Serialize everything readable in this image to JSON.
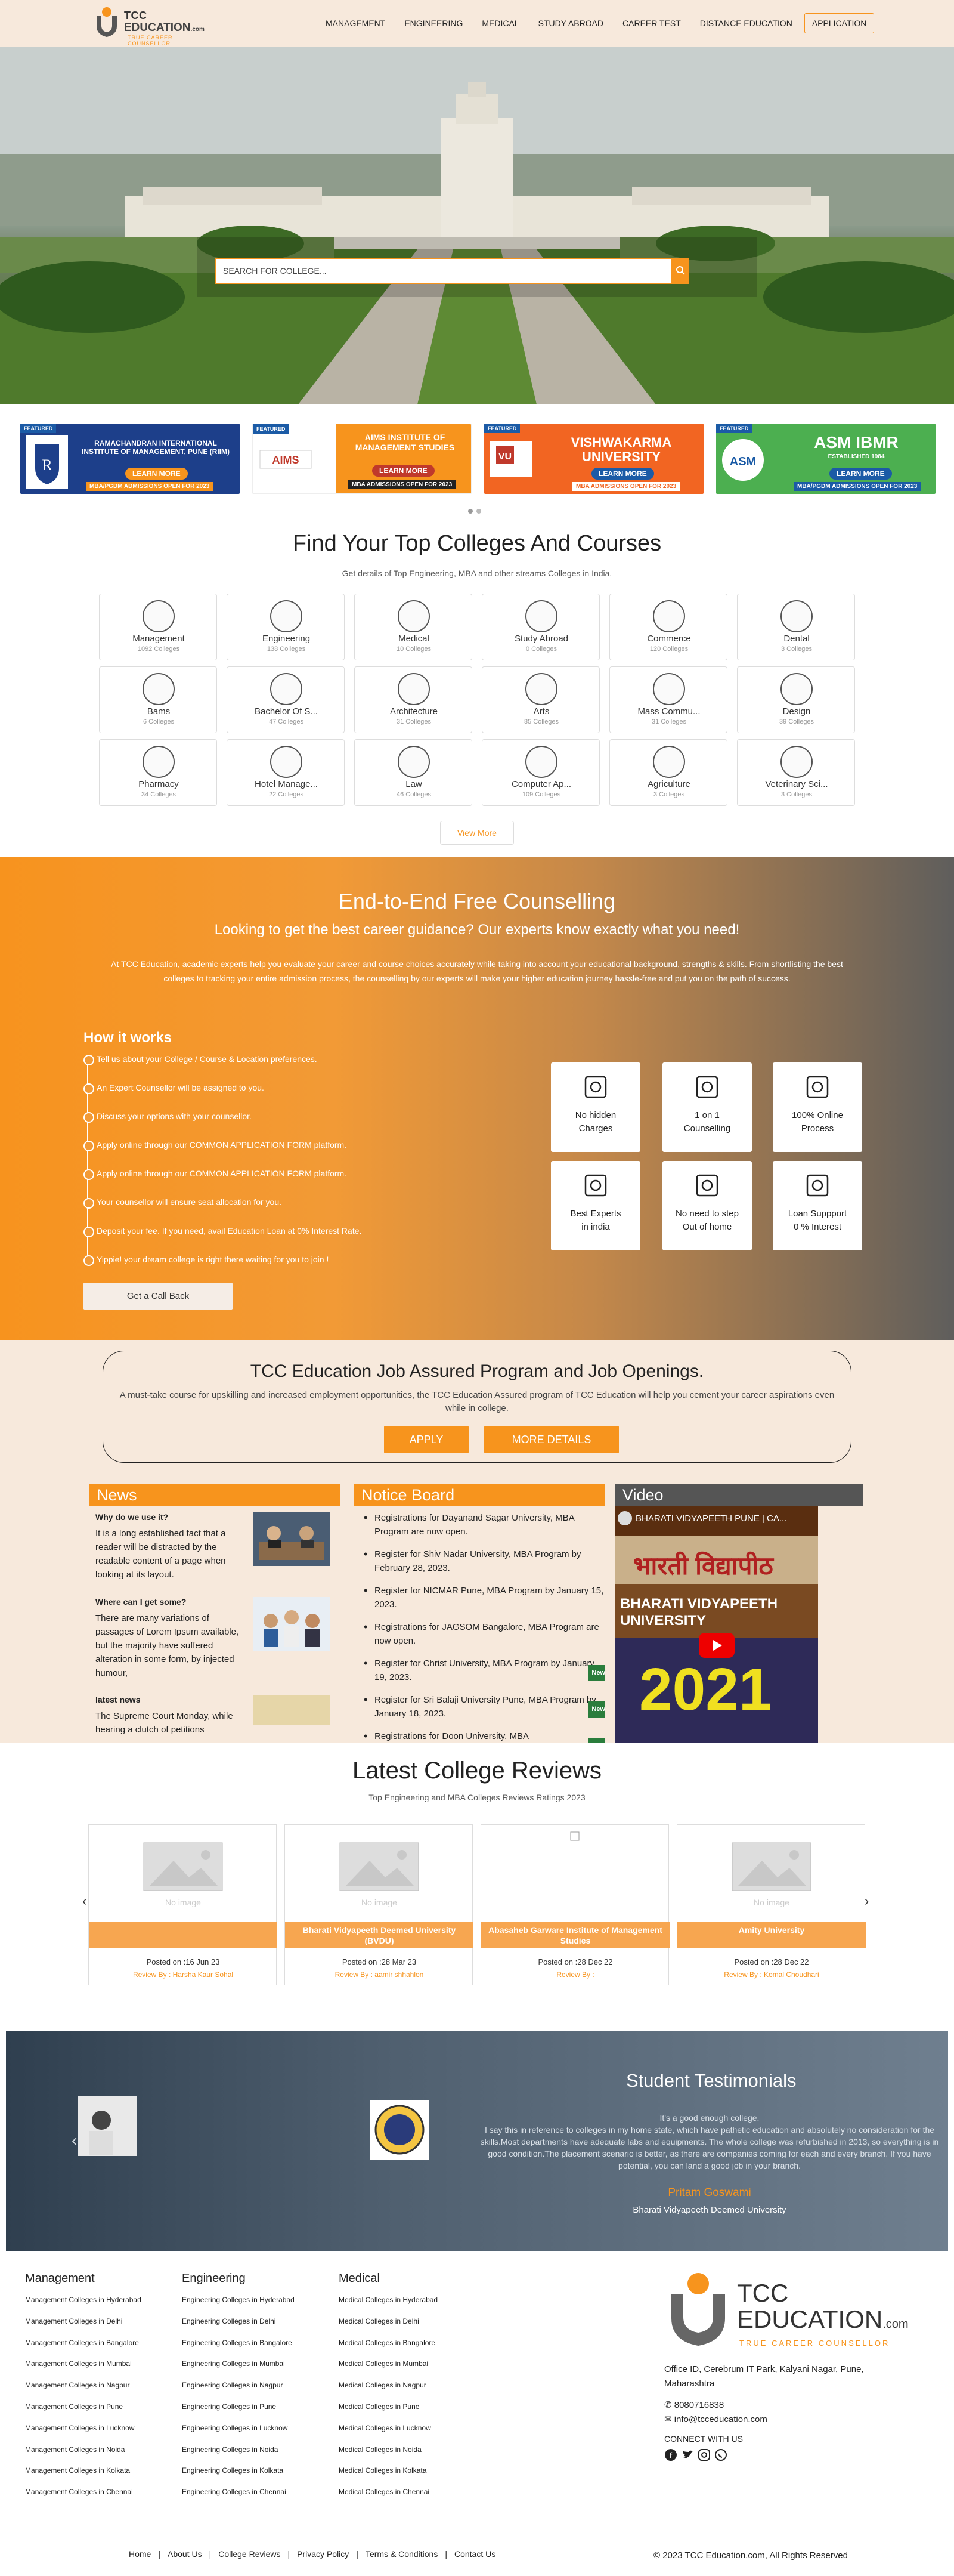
{
  "header": {
    "logo_line1": "TCC",
    "logo_line2": "EDUCATION",
    "logo_com": ".com",
    "logo_tagline": "TRUE CAREER COUNSELLOR",
    "nav": [
      "MANAGEMENT",
      "ENGINEERING",
      "MEDICAL",
      "STUDY ABROAD",
      "CAREER TEST",
      "DISTANCE EDUCATION"
    ],
    "application_label": "APPLICATION"
  },
  "hero": {
    "search_placeholder": "SEARCH FOR COLLEGE...",
    "search_icon": "search-icon"
  },
  "banners": [
    {
      "featured": "FEATURED",
      "title": "RAMACHANDRAN INTERNATIONAL INSTITUTE OF MANAGEMENT, PUNE (RIIM)",
      "learn": "LEARN MORE",
      "admission": "MBA/PGDM ADMISSIONS OPEN FOR 2023"
    },
    {
      "featured": "FEATURED",
      "title": "AIMS INSTITUTE OF MANAGEMENT STUDIES",
      "learn": "LEARN MORE",
      "admission": "MBA ADMISSIONS OPEN FOR 2023"
    },
    {
      "featured": "FEATURED",
      "title": "VISHWAKARMA UNIVERSITY",
      "learn": "LEARN MORE",
      "admission": "MBA ADMISSIONS OPEN FOR 2023"
    },
    {
      "featured": "FEATURED",
      "title": "ASM IBMR",
      "subtitle": "ESTABLISHED 1984",
      "learn": "LEARN MORE",
      "admission": "MBA/PGDM ADMISSIONS OPEN FOR 2023"
    }
  ],
  "top_colleges": {
    "title": "Find Your Top Colleges And Courses",
    "subtitle": "Get details of Top Engineering, MBA and other streams Colleges in India.",
    "items": [
      {
        "name": "Management",
        "count": "1092 Colleges",
        "icon": "management-icon"
      },
      {
        "name": "Engineering",
        "count": "138 Colleges",
        "icon": "engineering-icon"
      },
      {
        "name": "Medical",
        "count": "10 Colleges",
        "icon": "medical-icon"
      },
      {
        "name": "Study Abroad",
        "count": "0 Colleges",
        "icon": "globe-icon"
      },
      {
        "name": "Commerce",
        "count": "120 Colleges",
        "icon": "commerce-icon"
      },
      {
        "name": "Dental",
        "count": "3 Colleges",
        "icon": "tooth-icon"
      },
      {
        "name": "Bams",
        "count": "6 Colleges",
        "icon": "bams-icon"
      },
      {
        "name": "Bachelor Of S...",
        "count": "47 Colleges",
        "icon": "science-icon"
      },
      {
        "name": "Architecture",
        "count": "31 Colleges",
        "icon": "architecture-icon"
      },
      {
        "name": "Arts",
        "count": "85 Colleges",
        "icon": "arts-icon"
      },
      {
        "name": "Mass Commu...",
        "count": "31 Colleges",
        "icon": "mass-comm-icon"
      },
      {
        "name": "Design",
        "count": "39 Colleges",
        "icon": "design-icon"
      },
      {
        "name": "Pharmacy",
        "count": "34 Colleges",
        "icon": "pharmacy-icon"
      },
      {
        "name": "Hotel Manage...",
        "count": "22 Colleges",
        "icon": "hotel-icon"
      },
      {
        "name": "Law",
        "count": "46 Colleges",
        "icon": "law-icon"
      },
      {
        "name": "Computer Ap...",
        "count": "109 Colleges",
        "icon": "computer-icon"
      },
      {
        "name": "Agriculture",
        "count": "3 Colleges",
        "icon": "agriculture-icon"
      },
      {
        "name": "Veterinary Sci...",
        "count": "3 Colleges",
        "icon": "veterinary-icon"
      }
    ],
    "view_more": "View More"
  },
  "counselling": {
    "title": "End-to-End Free Counselling",
    "subtitle": "Looking to get the best career guidance? Our experts know exactly what you need!",
    "paragraph": "At TCC Education, academic experts help you evaluate your career and course choices accurately while taking into account your educational background, strengths & skills. From shortlisting the best colleges to tracking your entire admission process, the counselling by our experts will make your higher education journey hassle-free and put you on the path of success.",
    "how_title": "How it works",
    "steps": [
      "Tell us about your College / Course & Location preferences.",
      "An Expert Counsellor will be assigned to you.",
      "Discuss your options with your counsellor.",
      "Apply online through our COMMON APPLICATION FORM platform.",
      "Apply online through our COMMON APPLICATION FORM platform.",
      "Your counsellor will ensure seat allocation for you.",
      "Deposit your fee. If you need, avail Education Loan at 0% Interest Rate.",
      "Yippie! your dream college is right there waiting for you to join !"
    ],
    "callback": "Get a Call Back",
    "features": [
      {
        "label1": "No hidden",
        "label2": "Charges",
        "icon": "no-hidden-charges-icon"
      },
      {
        "label1": "1 on 1",
        "label2": "Counselling",
        "icon": "one-on-one-icon"
      },
      {
        "label1": "100% Online",
        "label2": "Process",
        "icon": "online-process-icon"
      },
      {
        "label1": "Best Experts",
        "label2": "in india",
        "icon": "experts-icon"
      },
      {
        "label1": "No need to step",
        "label2": "Out of home",
        "icon": "home-icon"
      },
      {
        "label1": "Loan Suppport",
        "label2": "0 % Interest",
        "icon": "loan-icon"
      }
    ]
  },
  "job": {
    "title": "TCC Education Job Assured Program and Job Openings.",
    "text": "A must-take course for upskilling and increased employment opportunities, the TCC Education Assured program of TCC Education will help you cement your career aspirations even while in college.",
    "apply": "APPLY",
    "more": "MORE DETAILS"
  },
  "news": {
    "heading": "News",
    "items": [
      {
        "title": "Why do we use it?",
        "body": "It is a long established fact that a reader will be distracted by the readable content of a page when looking at its layout."
      },
      {
        "title": "Where can I get some?",
        "body": "There are many variations of passages of Lorem Ipsum available, but the majority have suffered alteration in some form, by injected humour,"
      },
      {
        "title": "latest news",
        "body": "The Supreme Court Monday, while hearing a clutch of petitions"
      }
    ]
  },
  "notice": {
    "heading": "Notice Board",
    "items": [
      {
        "text": "Registrations for Dayanand Sagar University, MBA Program are now open.",
        "badge": ""
      },
      {
        "text": "Register for Shiv Nadar University, MBA Program by February 28, 2023.",
        "badge": ""
      },
      {
        "text": "Register for NICMAR Pune, MBA Program by January 15, 2023.",
        "badge": ""
      },
      {
        "text": "Registrations for JAGSOM Bangalore, MBA Program are now open.",
        "badge": ""
      },
      {
        "text": "Register for Christ University, MBA Program by January 19, 2023.",
        "badge": "New"
      },
      {
        "text": "Register for Sri Balaji University Pune, MBA Program by January 18, 2023.",
        "badge": "New"
      },
      {
        "text": "Registrations for Doon University, MBA",
        "badge": "New"
      }
    ]
  },
  "video": {
    "heading": "Video",
    "title": "BHARATI VIDYAPEETH PUNE | CA...",
    "overlay_hindi": "भारती विद्यापीठ",
    "overlay_en": "BHARATI VIDYAPEETH UNIVERSITY",
    "year": "2021"
  },
  "reviews": {
    "title": "Latest College Reviews",
    "subtitle": "Top Engineering and MBA Colleges Reviews Ratings 2023",
    "cards": [
      {
        "image_text": "No image",
        "name": "",
        "posted": "Posted on :16 Jun 23",
        "review_by": "Review By : Harsha Kaur Sohal"
      },
      {
        "image_text": "No image",
        "name": "Bharati Vidyapeeth Deemed University (BVDU)",
        "posted": "Posted on :28 Mar 23",
        "review_by": "Review By : aamir shhahlon"
      },
      {
        "image_text": "",
        "name": "Abasaheb Garware Institute of Management Studies",
        "posted": "Posted on :28 Dec 22",
        "review_by": "Review By :"
      },
      {
        "image_text": "No image",
        "name": "Amity University",
        "posted": "Posted on :28 Dec 22",
        "review_by": "Review By : Komal Choudhari"
      }
    ]
  },
  "testimonials": {
    "title": "Student Testimonials",
    "quote": "It's a good enough college.\nI say this in reference to colleges in my home state, which have pathetic education and absolutely no consideration for the skills.Most departments have adequate labs and equipments. The whole college was refurbished in 2013, so everything is in good condition.The placement scenario is better, as there are companies coming for each and every branch. If you have potential, you can land a good job in your branch.",
    "name": "Pritam Goswami",
    "college": "Bharati Vidyapeeth Deemed University"
  },
  "footer": {
    "columns": [
      {
        "heading": "Management",
        "links": [
          "Management Colleges in Hyderabad",
          "Management Colleges in Delhi",
          "Management Colleges in Bangalore",
          "Management Colleges in Mumbai",
          "Management Colleges in Nagpur",
          "Management Colleges in Pune",
          "Management Colleges in Lucknow",
          "Management Colleges in Noida",
          "Management Colleges in Kolkata",
          "Management Colleges in Chennai"
        ]
      },
      {
        "heading": "Engineering",
        "links": [
          "Engineering Colleges in Hyderabad",
          "Engineering Colleges in Delhi",
          "Engineering Colleges in Bangalore",
          "Engineering Colleges in Mumbai",
          "Engineering Colleges in Nagpur",
          "Engineering Colleges in Pune",
          "Engineering Colleges in Lucknow",
          "Engineering Colleges in Noida",
          "Engineering Colleges in Kolkata",
          "Engineering Colleges in Chennai"
        ]
      },
      {
        "heading": "Medical",
        "links": [
          "Medical Colleges in Hyderabad",
          "Medical Colleges in Delhi",
          "Medical Colleges in Bangalore",
          "Medical Colleges in Mumbai",
          "Medical Colleges in Nagpur",
          "Medical Colleges in Pune",
          "Medical Colleges in Lucknow",
          "Medical Colleges in Noida",
          "Medical Colleges in Kolkata",
          "Medical Colleges in Chennai"
        ]
      }
    ],
    "logo_line1": "TCC",
    "logo_line2": "EDUCATION",
    "logo_com": ".com",
    "logo_tagline": "TRUE CAREER COUNSELLOR",
    "address": "Office ID, Cerebrum IT Park, Kalyani Nagar, Pune, Maharashtra",
    "phone": "8080716838",
    "email": "info@tcceducation.com",
    "connect": "CONNECT WITH US",
    "nav": [
      "Home",
      "About Us",
      "College Reviews",
      "Privacy Policy",
      "Terms & Conditions",
      "Contact Us"
    ],
    "copyright": "© 2023 TCC Education.com, All Rights Reserved"
  },
  "colors": {
    "accent": "#f7941d",
    "header_bg": "#f7e9dc",
    "dark": "#222222"
  }
}
